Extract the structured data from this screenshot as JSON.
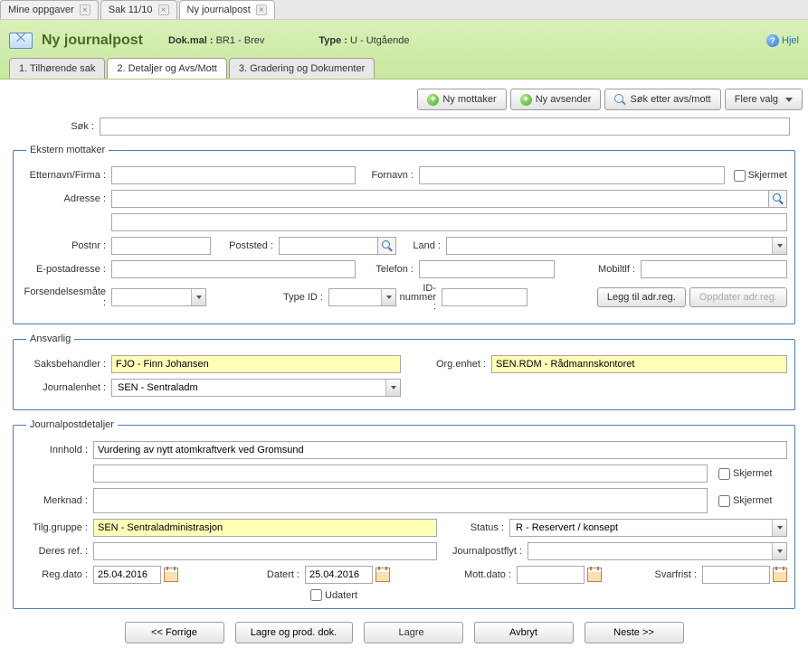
{
  "doc_tabs": [
    {
      "label": "Mine oppgaver",
      "active": false
    },
    {
      "label": "Sak 11/10",
      "active": false
    },
    {
      "label": "Ny journalpost",
      "active": true
    }
  ],
  "header": {
    "title": "Ny journalpost",
    "dokmal_label": "Dok.mal :",
    "dokmal_value": "BR1 - Brev",
    "type_label": "Type :",
    "type_value": "U - Utgående",
    "help": "Hjel"
  },
  "sub_tabs": [
    {
      "label": "1. Tilhørende sak",
      "active": false
    },
    {
      "label": "2. Detaljer og Avs/Mott",
      "active": true
    },
    {
      "label": "3. Gradering og Dokumenter",
      "active": false
    }
  ],
  "toolbar": {
    "ny_mottaker": "Ny mottaker",
    "ny_avsender": "Ny avsender",
    "sok_avs_mott": "Søk etter avs/mott",
    "flere_valg": "Flere valg"
  },
  "search": {
    "label": "Søk :",
    "value": ""
  },
  "ekstern": {
    "legend": "Ekstern mottaker",
    "etternavn_label": "Etternavn/Firma :",
    "etternavn_value": "",
    "fornavn_label": "Fornavn :",
    "fornavn_value": "",
    "skjermet_label": "Skjermet",
    "adresse_label": "Adresse :",
    "adresse_value": "",
    "adresse2_value": "",
    "postnr_label": "Postnr :",
    "postnr_value": "",
    "poststed_label": "Poststed :",
    "poststed_value": "",
    "land_label": "Land :",
    "land_value": "",
    "epost_label": "E-postadresse :",
    "epost_value": "",
    "telefon_label": "Telefon :",
    "telefon_value": "",
    "mobil_label": "Mobiltlf :",
    "mobil_value": "",
    "forsendelse_label": "Forsendelsesmåte :",
    "forsendelse_value": "",
    "typeid_label": "Type ID :",
    "typeid_value": "",
    "idnummer_label": "ID-nummer :",
    "idnummer_value": "",
    "legg_til_btn": "Legg til adr.reg.",
    "oppdater_btn": "Oppdater adr.reg."
  },
  "ansvarlig": {
    "legend": "Ansvarlig",
    "saksbehandler_label": "Saksbehandler :",
    "saksbehandler_value": "FJO - Finn Johansen",
    "orgenhet_label": "Org.enhet :",
    "orgenhet_value": "SEN.RDM - Rådmannskontoret",
    "journalenhet_label": "Journalenhet :",
    "journalenhet_value": "SEN - Sentraladm"
  },
  "detaljer": {
    "legend": "Journalpostdetaljer",
    "innhold_label": "Innhold :",
    "innhold_value": "Vurdering av nytt atomkraftverk ved Gromsund",
    "innhold2_value": "",
    "skjermet1_label": "Skjermet",
    "merknad_label": "Merknad :",
    "merknad_value": "",
    "skjermet2_label": "Skjermet",
    "tilg_label": "Tilg.gruppe :",
    "tilg_value": "SEN - Sentraladministrasjon",
    "status_label": "Status :",
    "status_value": "R - Reservert / konsept",
    "deresref_label": "Deres ref. :",
    "deresref_value": "",
    "jpflyt_label": "Journalpostflyt :",
    "jpflyt_value": "",
    "regdato_label": "Reg.dato :",
    "regdato_value": "25.04.2016",
    "datert_label": "Datert :",
    "datert_value": "25.04.2016",
    "mottdato_label": "Mott.dato :",
    "mottdato_value": "",
    "svarfrist_label": "Svarfrist :",
    "svarfrist_value": "",
    "udatert_label": "Udatert"
  },
  "bottom": {
    "forrige": "<< Forrige",
    "lagre_prod": "Lagre og prod. dok.",
    "lagre": "Lagre",
    "avbryt": "Avbryt",
    "neste": "Neste >>"
  }
}
